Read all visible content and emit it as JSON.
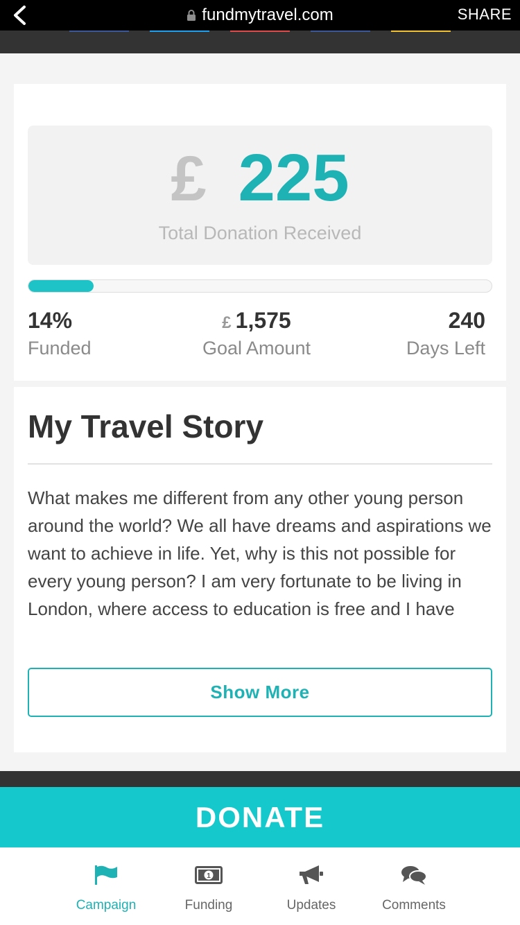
{
  "browser": {
    "url": "fundmytravel.com",
    "share_label": "SHARE"
  },
  "share_strip": {
    "colors": [
      "#3b5998",
      "#1da1f2",
      "#e04b4b",
      "#3b5998",
      "#f4c430"
    ]
  },
  "campaign": {
    "currency_symbol": "£",
    "total_amount": "225",
    "total_label": "Total Donation Received",
    "progress_percent": 14,
    "stats": {
      "funded_value": "14%",
      "funded_label": "Funded",
      "goal_currency": "£",
      "goal_value": "1,575",
      "goal_label": "Goal Amount",
      "days_value": "240",
      "days_label": "Days Left"
    }
  },
  "story": {
    "title": "My Travel Story",
    "text": "What makes me different from any other young person around the world? We all have dreams and aspirations we want to achieve in life. Yet, why is this not possible for every young person? I am very fortunate to be living in London, where access to education is free and I have",
    "show_more_label": "Show More"
  },
  "donate_label": "DONATE",
  "tabs": [
    {
      "label": "Campaign",
      "icon": "flag-icon",
      "active": true
    },
    {
      "label": "Funding",
      "icon": "banknote-icon",
      "active": false
    },
    {
      "label": "Updates",
      "icon": "megaphone-icon",
      "active": false
    },
    {
      "label": "Comments",
      "icon": "comments-icon",
      "active": false
    }
  ],
  "colors": {
    "accent": "#1eb2b5",
    "donate": "#14c8cb",
    "dark": "#333333"
  }
}
